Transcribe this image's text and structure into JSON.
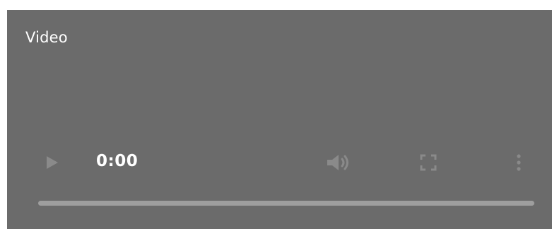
{
  "player": {
    "title": "Video",
    "current_time": "0:00",
    "progress": 0,
    "colors": {
      "background": "#6b6b6b",
      "text": "#ffffff",
      "icon_dim": "#8a8a8a",
      "track": "#9e9e9e"
    },
    "icons": {
      "play": "play-icon",
      "volume": "volume-icon",
      "fullscreen": "fullscreen-icon",
      "more": "more-options-icon"
    }
  }
}
